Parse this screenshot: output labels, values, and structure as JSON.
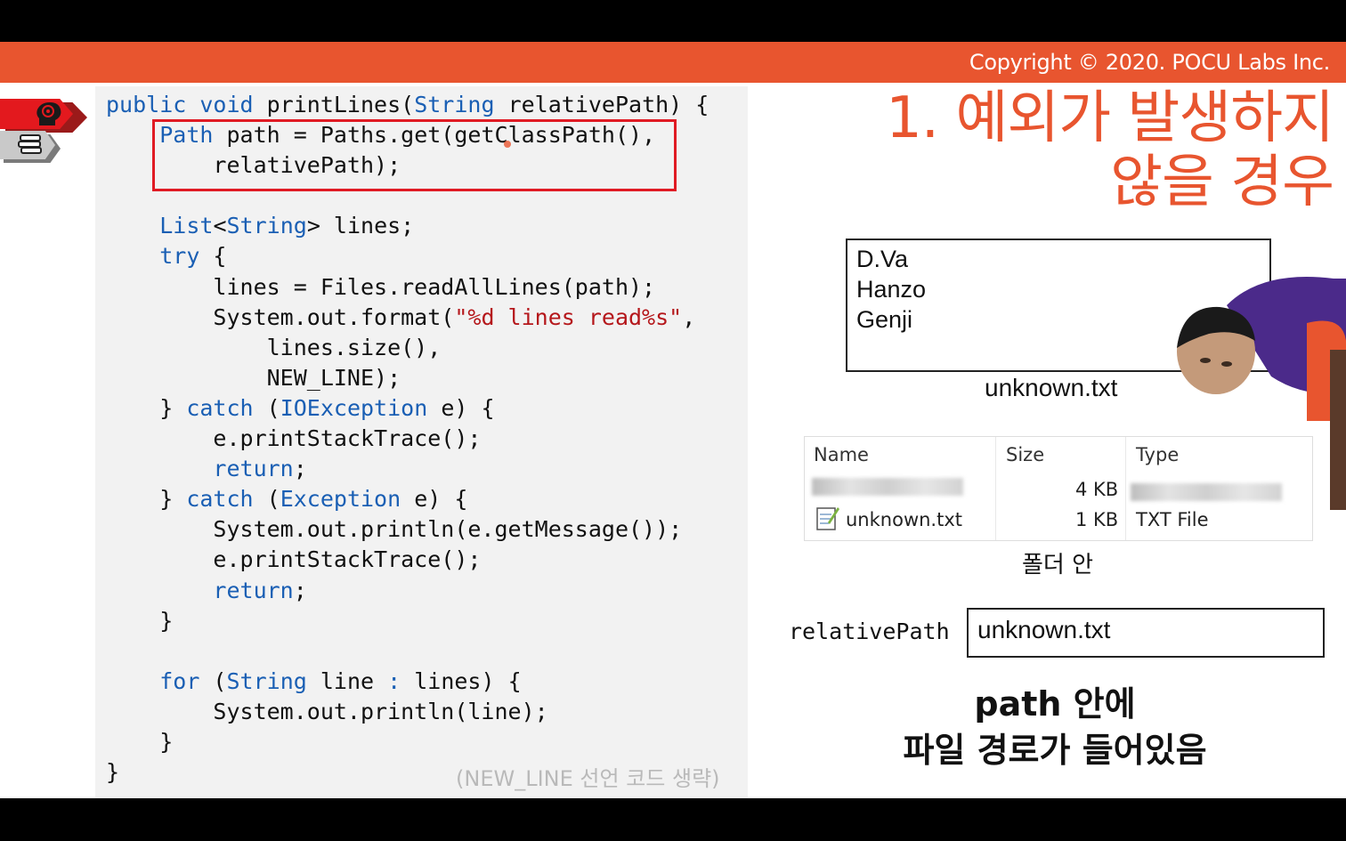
{
  "header": {
    "copyright": "Copyright © 2020. POCU Labs Inc."
  },
  "sidebar": {
    "icons": [
      "brain-icon",
      "books-icon"
    ]
  },
  "code": {
    "lines": [
      "public void printLines(String relativePath) {",
      "    Path path = Paths.get(getClassPath(),",
      "        relativePath);",
      "",
      "    List<String> lines;",
      "    try {",
      "        lines = Files.readAllLines(path);",
      "        System.out.format(\"%d lines read%s\",",
      "            lines.size(),",
      "            NEW_LINE);",
      "    } catch (IOException e) {",
      "        e.printStackTrace();",
      "        return;",
      "    } catch (Exception e) {",
      "        System.out.println(e.getMessage());",
      "        e.printStackTrace();",
      "        return;",
      "    }",
      "",
      "    for (String line : lines) {",
      "        System.out.println(line);",
      "    }",
      "}"
    ],
    "note": "(NEW_LINE 선언 코드 생략)"
  },
  "slide": {
    "title_line1": "1. 예외가 발생하지",
    "title_line2": "않을 경우",
    "file": {
      "lines": [
        "D.Va",
        "Hanzo",
        "Genji"
      ],
      "name": "unknown.txt"
    },
    "explorer": {
      "headers": {
        "name": "Name",
        "size": "Size",
        "type": "Type"
      },
      "rows": [
        {
          "name": "",
          "size": "4 KB",
          "type": ""
        },
        {
          "name": "unknown.txt",
          "size": "1 KB",
          "type": "TXT File"
        }
      ],
      "caption": "폴더 안"
    },
    "relative_path": {
      "label": "relativePath",
      "value": "unknown.txt"
    },
    "caption_line1": "path 안에",
    "caption_line2": "파일 경로가 들어있음"
  },
  "colors": {
    "accent": "#e8552f",
    "keyword": "#1a5fb4",
    "string": "#b5171b",
    "highlight": "#e01b24"
  }
}
